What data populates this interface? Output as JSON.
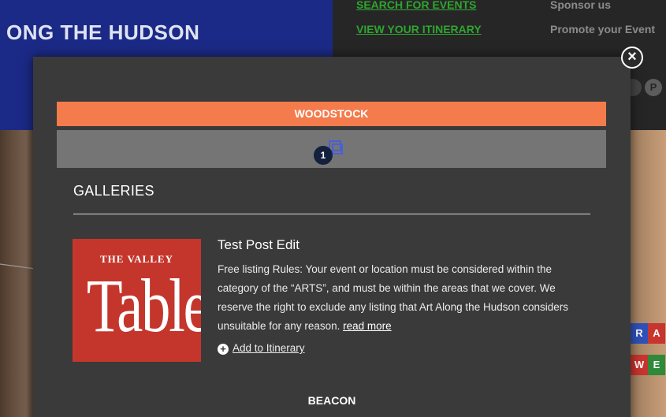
{
  "background": {
    "site_title": "ONG THE HUDSON",
    "nav": {
      "search_events": "SEARCH FOR EVENTS",
      "view_itinerary": "VIEW YOUR ITINERARY",
      "sponsor": "Sponsor us",
      "promote": "Promote your Event"
    },
    "tiles": [
      "R",
      "A",
      "W",
      "E"
    ],
    "social_icon": "pinterest-icon"
  },
  "modal": {
    "location_name": "WOODSTOCK",
    "map_marker_count": "1",
    "category_heading": "GALLERIES",
    "listing": {
      "title": "Test Post Edit",
      "description": "Free listing Rules: Your event or location must be considered within the category of the “ARTS”, and must be within the areas that we cover. We reserve the right to exclude any listing that Art Along the Hudson considers unsuitable for any reason.",
      "read_more": "read more",
      "add_to_itinerary": "Add to Itinerary",
      "image_logo_top": "THE VALLEY",
      "image_logo_main": "Table"
    },
    "next_location_name": "BEACON",
    "close_symbol": "×",
    "plus_symbol": "+"
  },
  "colors": {
    "location_bar": "#f47b4c",
    "modal_bg": "#3a3a3a",
    "link_green": "#2fa52f",
    "header_blue": "#1b2a86"
  }
}
